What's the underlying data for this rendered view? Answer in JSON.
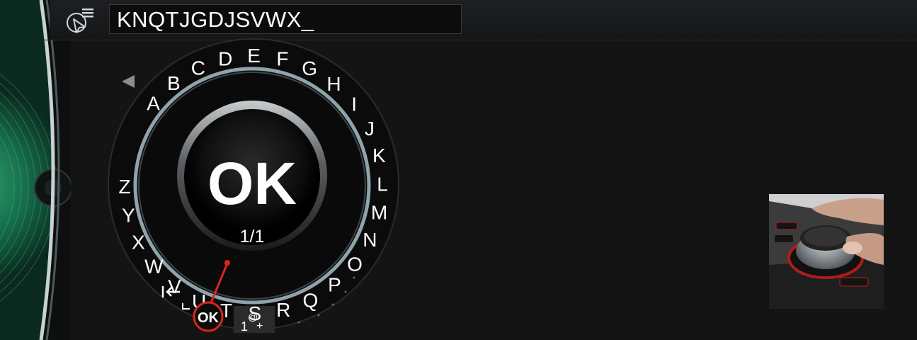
{
  "input": {
    "text": "KNQTJGDJSVWX_"
  },
  "speller": {
    "letters": [
      "A",
      "B",
      "C",
      "D",
      "E",
      "F",
      "G",
      "H",
      "I",
      "J",
      "K",
      "L",
      "M",
      "N",
      "O",
      "P",
      "Q",
      "R",
      "S",
      "T",
      "U",
      "V",
      "W",
      "X",
      "Y",
      "Z"
    ],
    "center_label": "OK",
    "page_indicator": "1/1",
    "ok_button_label": "OK",
    "symbols_label_main": "1",
    "symbols_label_top": "@",
    "symbols_label_plus": "+",
    "backspace_icon": "backspace-arrow-icon",
    "prev_page_icon": "left-triangle-icon"
  },
  "colors": {
    "accent": "#d9261c",
    "ring": "#8fa3ab",
    "deco_green": "#1f7a55"
  }
}
